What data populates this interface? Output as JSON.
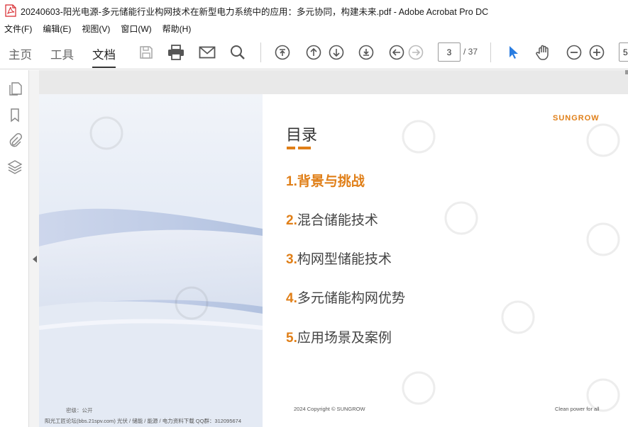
{
  "window": {
    "title": "20240603-阳光电源-多元储能行业构网技术在新型电力系统中的应用：多元协同，构建未来.pdf - Adobe Acrobat Pro DC"
  },
  "menu": [
    "文件(F)",
    "编辑(E)",
    "视图(V)",
    "窗口(W)",
    "帮助(H)"
  ],
  "tabs": {
    "home": "主页",
    "tools": "工具",
    "document": "文档",
    "active": "document"
  },
  "toolbar": {
    "icons": [
      "save-icon",
      "print-icon",
      "email-icon",
      "search-icon",
      "first-page-icon",
      "prev-page-icon",
      "next-page-icon",
      "last-page-icon",
      "back-icon",
      "forward-icon",
      "select-cursor-icon",
      "hand-icon",
      "zoom-out-icon",
      "zoom-in-icon"
    ],
    "page_current": "3",
    "page_total": "/ 37",
    "zoom_value": "5"
  },
  "left_panel": {
    "icons": [
      "page-thumbnails-icon",
      "bookmark-icon",
      "attachment-icon",
      "layers-icon"
    ]
  },
  "slide": {
    "brand": "SUNGROW",
    "toc_title": "目录",
    "items": [
      {
        "num": "1.",
        "label": "背景与挑战",
        "active": true
      },
      {
        "num": "2.",
        "label": "混合储能技术",
        "active": false
      },
      {
        "num": "3.",
        "label": "构网型储能技术",
        "active": false
      },
      {
        "num": "4.",
        "label": "多元储能构网优势",
        "active": false
      },
      {
        "num": "5.",
        "label": "应用场景及案例",
        "active": false
      }
    ],
    "confidential": "密级：公开",
    "copyright": "2024 Copyright © SUNGROW",
    "slogan": "Clean power for all",
    "forum_line": "阳光工匠论坛(bbs.21spv.com)    光伏 / 储能 / 能源 / 电力资料下载    QQ群：312095674"
  },
  "colors": {
    "accent": "#e07f18",
    "acrobat_red": "#d7262b",
    "select_blue": "#2a7de1"
  }
}
